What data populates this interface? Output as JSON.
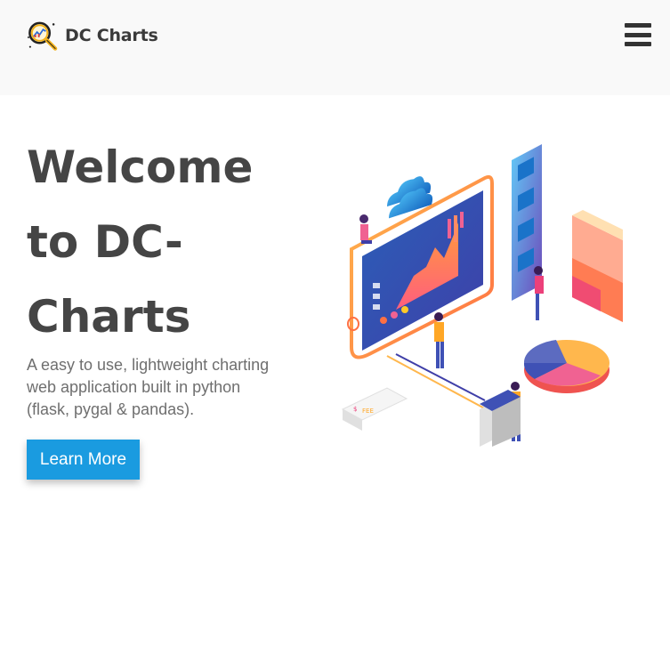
{
  "navbar": {
    "brand_name": "DC Charts",
    "logo_icon": "magnifier-chart-icon",
    "menu_icon": "hamburger-menu-icon"
  },
  "hero": {
    "title": "Welcome to DC-Charts",
    "subtitle": "A easy to use, lightweight charting web application built in python (flask, pygal & pandas).",
    "cta_label": "Learn More",
    "illustration": "isometric-data-dashboard-illustration",
    "illustration_labels": [
      "$",
      "FEE"
    ]
  },
  "colors": {
    "cta_background": "#1a9be0",
    "title_text": "#454545",
    "subtitle_text": "#6f6f6f",
    "navbar_background": "#f9f9f9"
  }
}
